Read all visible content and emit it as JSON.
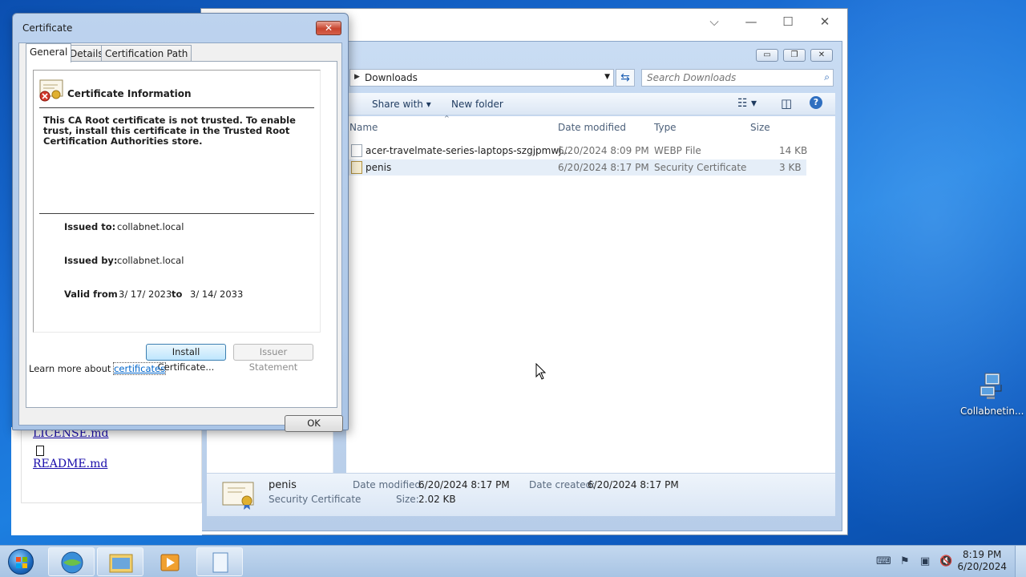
{
  "desktop": {
    "icon_label": "Collabnetin..."
  },
  "explorer": {
    "address": "Downloads",
    "search_placeholder": "Search Downloads",
    "commands": {
      "share_with": "Share with",
      "new_folder": "New folder"
    },
    "columns": {
      "name": "Name",
      "date": "Date modified",
      "type": "Type",
      "size": "Size"
    },
    "files": [
      {
        "name": "acer-travelmate-series-laptops-szgjpmwj...",
        "date": "6/20/2024 8:09 PM",
        "type": "WEBP File",
        "size": "14 KB"
      },
      {
        "name": "penis",
        "date": "6/20/2024 8:17 PM",
        "type": "Security Certificate",
        "size": "3 KB"
      }
    ],
    "details": {
      "name": "penis",
      "type": "Security Certificate",
      "date_modified_label": "Date modified:",
      "date_modified": "6/20/2024 8:17 PM",
      "date_created_label": "Date created:",
      "date_created": "6/20/2024 8:17 PM",
      "size_label": "Size:",
      "size": "2.02 KB"
    }
  },
  "web_page": {
    "links": [
      "LICENSE.md",
      "README.md"
    ]
  },
  "certificate": {
    "title": "Certificate",
    "tabs": [
      "General",
      "Details",
      "Certification Path"
    ],
    "active_tab": "General",
    "info_title": "Certificate Information",
    "warning": "This CA Root certificate is not trusted. To enable trust, install this certificate in the Trusted Root Certification Authorities store.",
    "issued_to_label": "Issued to:",
    "issued_to": "collabnet.local",
    "issued_by_label": "Issued by:",
    "issued_by": "collabnet.local",
    "valid_from_label": "Valid from",
    "valid_from": "3/ 17/ 2023",
    "to_label": "to",
    "valid_to": "3/ 14/ 2033",
    "install_button": "Install Certificate...",
    "issuer_statement_button": "Issuer Statement",
    "learn_more": "Learn more about",
    "learn_more_link": "certificates",
    "ok_button": "OK"
  },
  "taskbar": {
    "time": "8:19 PM",
    "date": "6/20/2024"
  },
  "colors": {
    "desktop_blue": "#1a6fd6",
    "selection": "#e5eef8",
    "close_red": "#c8452f",
    "link_blue": "#0066cc"
  }
}
